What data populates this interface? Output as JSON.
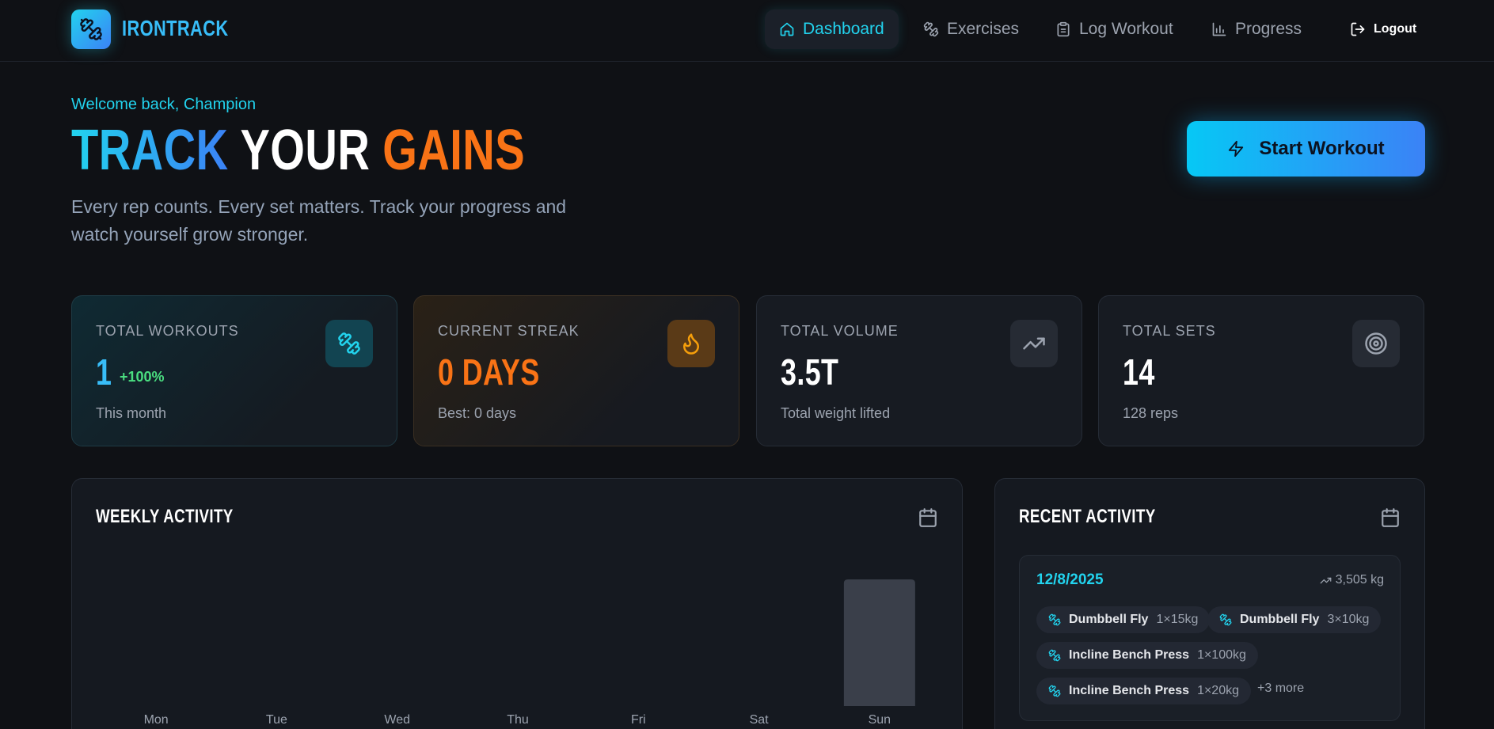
{
  "app": {
    "brand": "IRONTRACK",
    "accent": "#22d3ee",
    "accent2": "#3b82f6",
    "orange": "#f97316"
  },
  "nav": {
    "items": [
      {
        "label": "Dashboard",
        "icon": "home-icon",
        "active": true
      },
      {
        "label": "Exercises",
        "icon": "dumbbell-icon",
        "active": false
      },
      {
        "label": "Log Workout",
        "icon": "clipboard-icon",
        "active": false
      },
      {
        "label": "Progress",
        "icon": "bar-chart-icon",
        "active": false
      }
    ],
    "logout": "Logout"
  },
  "hero": {
    "welcome": "Welcome back, Champion",
    "title_part1": "TRACK",
    "title_part2": "YOUR",
    "title_part3": "GAINS",
    "subtitle": "Every rep counts. Every set matters. Track your progress and watch yourself grow stronger.",
    "cta": "Start Workout"
  },
  "stats": [
    {
      "label": "TOTAL WORKOUTS",
      "value": "1",
      "change": "+100%",
      "foot": "This month",
      "icon": "dumbbell-icon"
    },
    {
      "label": "CURRENT STREAK",
      "value": "0 DAYS",
      "foot": "Best: 0 days",
      "icon": "flame-icon"
    },
    {
      "label": "TOTAL VOLUME",
      "value": "3.5T",
      "foot": "Total weight lifted",
      "icon": "trending-up-icon"
    },
    {
      "label": "TOTAL SETS",
      "value": "14",
      "foot": "128 reps",
      "icon": "target-icon"
    }
  ],
  "weekly": {
    "title": "WEEKLY ACTIVITY",
    "icon": "calendar-icon"
  },
  "chart_data": {
    "type": "bar",
    "categories": [
      "Mon",
      "Tue",
      "Wed",
      "Thu",
      "Fri",
      "Sat",
      "Sun"
    ],
    "values": [
      0,
      0,
      0,
      0,
      0,
      0,
      1
    ],
    "title": "WEEKLY ACTIVITY",
    "xlabel": "",
    "ylabel": "",
    "grid": false,
    "bar_color": "#3a3f4a"
  },
  "recent": {
    "title": "RECENT ACTIVITY",
    "icon": "calendar-icon",
    "entries": [
      {
        "date": "12/8/2025",
        "volume": "3,505 kg",
        "exercises": [
          {
            "name": "Dumbbell Fly",
            "sets": "1×15kg"
          },
          {
            "name": "Dumbbell Fly",
            "sets": "3×10kg"
          },
          {
            "name": "Incline Bench Press",
            "sets": "1×100kg"
          },
          {
            "name": "Incline Bench Press",
            "sets": "1×20kg"
          }
        ],
        "more": "+3 more"
      }
    ]
  }
}
